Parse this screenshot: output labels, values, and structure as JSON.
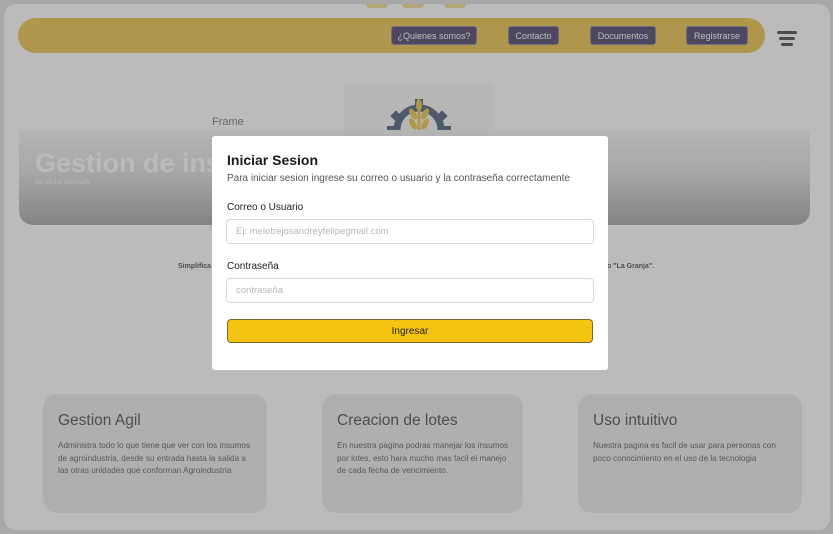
{
  "navbar": {
    "links": [
      {
        "label": "¿Quienes somos?"
      },
      {
        "label": "Contacto"
      },
      {
        "label": "Documentos"
      },
      {
        "label": "Registrarse"
      }
    ],
    "menu_icon": "hamburger-menu-icon"
  },
  "hero": {
    "frame_label": "Frame",
    "title": "Gestion de insumos",
    "subtitle": "SENA LA GRANJA",
    "logo_icon": "gear-wheat-logo-icon"
  },
  "intro": {
    "text_left": "Simplifica",
    "text_right": "o \"La Granja\"."
  },
  "features": [
    {
      "title": "Gestion Agil",
      "description": "Administra todo lo que tiene que ver con los insumos de agroindustria, desde su entrada hasta la salida a las otras unidades que conforman Agroindustria"
    },
    {
      "title": "Creacion de lotes",
      "description": "En nuestra pagina podras manejar los insumos por lotes, esto hara mucho mas facil el manejo de cada fecha de vencimiento."
    },
    {
      "title": "Uso intuitivo",
      "description": "Nuestra pagina es facil de usar para personas con poco conocimiento en el uso de la tecnologia"
    }
  ],
  "login": {
    "title": "Iniciar Sesion",
    "subtitle": "Para iniciar sesion ingrese su correo o usuario y la contraseña correctamente",
    "user_label": "Correo o Usuario",
    "user_placeholder": "Ej: melotrejosandreyfelipegmail.com",
    "user_value": "",
    "password_label": "Contraseña",
    "password_placeholder": "contraseña",
    "password_value": "",
    "submit_label": "Ingresar"
  },
  "colors": {
    "brand_yellow": "#e5b621",
    "button_yellow": "#f5c412",
    "nav_button": "#241648",
    "card_bg": "#ebe5eb"
  }
}
